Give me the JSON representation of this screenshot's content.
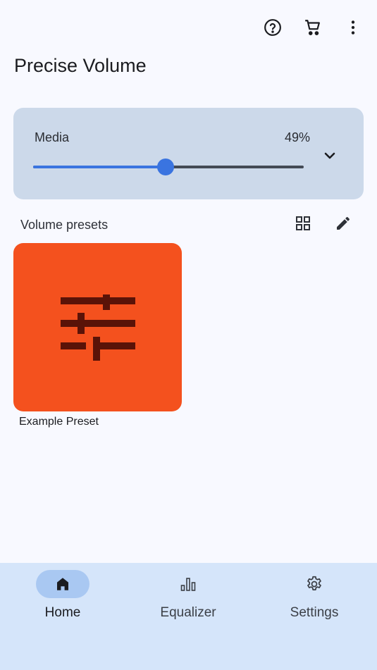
{
  "colors": {
    "background": "#f8f9ff",
    "card": "#ccd9ea",
    "accent": "#3a74e0",
    "preset_tile": "#f4511e",
    "preset_icon": "#5a1308",
    "nav_bar": "#d5e5fa",
    "nav_active_pill": "#a9c8f2"
  },
  "header": {
    "title": "Precise Volume",
    "icons": [
      "help-icon",
      "cart-icon",
      "more-vert-icon"
    ]
  },
  "volume": {
    "label": "Media",
    "percent_text": "49%",
    "level": 0.49,
    "expand_icon": "chevron-down-icon"
  },
  "presets": {
    "section_label": "Volume presets",
    "tools": [
      "grid-view-icon",
      "edit-icon"
    ],
    "items": [
      {
        "name": "Example Preset",
        "icon": "tune-icon"
      }
    ]
  },
  "nav": {
    "items": [
      {
        "label": "Home",
        "icon": "home-icon",
        "active": true
      },
      {
        "label": "Equalizer",
        "icon": "equalizer-icon",
        "active": false
      },
      {
        "label": "Settings",
        "icon": "settings-icon",
        "active": false
      }
    ]
  }
}
